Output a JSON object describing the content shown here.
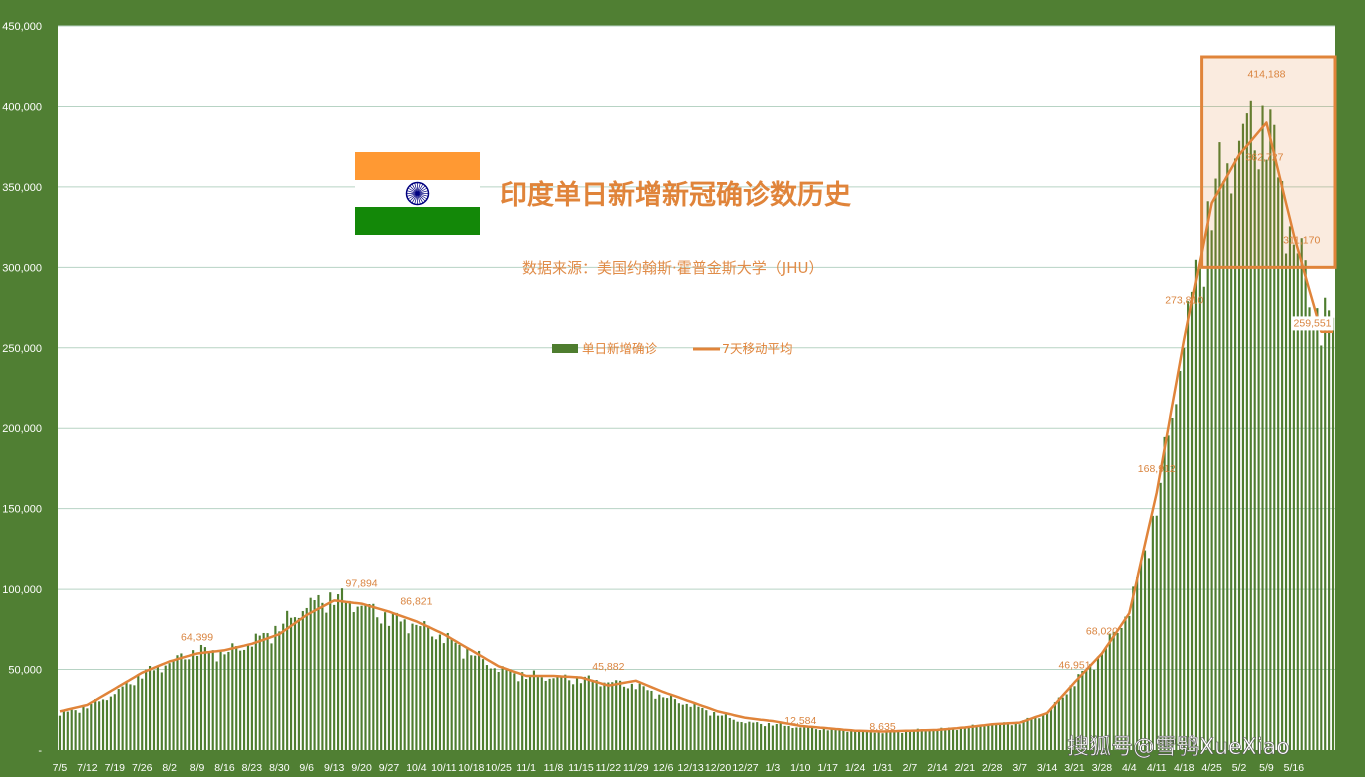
{
  "watermark": "搜狐号@雪鸮XueXiao",
  "legend": {
    "bar_label": "单日新增确诊",
    "line_label": "7天移动平均"
  },
  "colors": {
    "background": "#507f33",
    "plot_area": "#ffffff",
    "bar": "#4e7d2f",
    "line": "#e0843a",
    "gridline": "#b7d3c4",
    "highlight_box": "#e0843a",
    "flag_saffron": "#ff9933",
    "flag_white": "#ffffff",
    "flag_green": "#138808",
    "flag_chakra": "#000080"
  },
  "chart_data": {
    "type": "bar",
    "title": "印度单日新增新冠确诊数历史",
    "subtitle": "数据来源：美国约翰斯·霍普金斯大学（JHU）",
    "ylim": [
      0,
      450000
    ],
    "y_ticks": [
      "-",
      "50,000",
      "100,000",
      "150,000",
      "200,000",
      "250,000",
      "300,000",
      "350,000",
      "400,000",
      "450,000"
    ],
    "x_ticks": [
      "7/5",
      "7/12",
      "7/19",
      "7/26",
      "8/2",
      "8/9",
      "8/16",
      "8/23",
      "8/30",
      "9/6",
      "9/13",
      "9/20",
      "9/27",
      "10/4",
      "10/11",
      "10/18",
      "10/25",
      "11/1",
      "11/8",
      "11/15",
      "11/22",
      "11/29",
      "12/6",
      "12/13",
      "12/20",
      "12/27",
      "1/3",
      "1/10",
      "1/17",
      "1/24",
      "1/31",
      "2/7",
      "2/14",
      "2/21",
      "2/28",
      "3/7",
      "3/14",
      "3/21",
      "3/28",
      "4/4",
      "4/11",
      "4/18",
      "4/25",
      "5/2",
      "5/9",
      "5/16"
    ],
    "grid": true,
    "legend_position": "top-center",
    "series": [
      {
        "name": "单日新增确诊",
        "type": "bar",
        "weekly_anchor_values": [
          22000,
          27000,
          35000,
          47000,
          54000,
          62000,
          60000,
          67000,
          76000,
          90000,
          95000,
          90000,
          82000,
          78000,
          70000,
          60000,
          50000,
          46000,
          45000,
          44000,
          42000,
          40000,
          33000,
          28000,
          22000,
          17000,
          16000,
          14000,
          13000,
          12000,
          11000,
          12000,
          13000,
          14000,
          16000,
          17000,
          23000,
          42000,
          60000,
          87000,
          150000,
          255000,
          340000,
          380000,
          390000,
          315000,
          265000
        ]
      },
      {
        "name": "7天移动平均",
        "type": "line",
        "weekly_anchor_values": [
          24000,
          28000,
          38000,
          48000,
          55000,
          60000,
          62000,
          66000,
          72000,
          84000,
          93000,
          91000,
          86000,
          80000,
          72000,
          62000,
          52000,
          46000,
          46000,
          45000,
          40000,
          43000,
          36000,
          30000,
          24000,
          20000,
          18000,
          15000,
          13500,
          12000,
          11500,
          12000,
          12500,
          14000,
          16000,
          17000,
          23000,
          42000,
          60000,
          85000,
          160000,
          255000,
          340000,
          370000,
          390000,
          320000,
          260000
        ]
      }
    ],
    "data_labels": [
      {
        "x": "8/9",
        "value": "64,399"
      },
      {
        "x": "9/20",
        "value": "97,894"
      },
      {
        "x": "10/4",
        "value": "86,821"
      },
      {
        "x": "11/22",
        "value": "45,882"
      },
      {
        "x": "1/10",
        "value": "12,584"
      },
      {
        "x": "1/31",
        "value": "8,635"
      },
      {
        "x": "3/21",
        "value": "46,951"
      },
      {
        "x": "3/28",
        "value": "68,020"
      },
      {
        "x": "4/11",
        "value": "168,912"
      },
      {
        "x": "4/18",
        "value": "273,810"
      },
      {
        "x": "5/9",
        "value": "414,188"
      },
      {
        "x": "5/9",
        "value": "362,727"
      },
      {
        "x": "5/16",
        "value": "311,170"
      },
      {
        "x": "5/16",
        "value": "259,551"
      }
    ],
    "highlight": {
      "x_from": "4/25",
      "x_to": "5/16",
      "y_from": 300000,
      "y_to": 450000
    }
  }
}
